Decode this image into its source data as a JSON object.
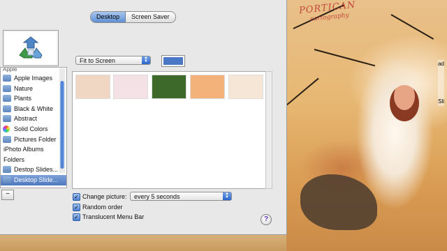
{
  "tabs": [
    {
      "label": "Desktop",
      "selected": true
    },
    {
      "label": "Screen Saver",
      "selected": false
    }
  ],
  "preview": {
    "icon": "refresh-cycle-icon"
  },
  "fit_popup": {
    "value": "Fit to Screen"
  },
  "color_swatch": {
    "color": "#4a77c6"
  },
  "sidebar": {
    "partial_header": "Apple",
    "items": [
      {
        "label": "Apple Images",
        "icon": "apple-logo-icon"
      },
      {
        "label": "Nature",
        "icon": "folder-icon"
      },
      {
        "label": "Plants",
        "icon": "folder-icon"
      },
      {
        "label": "Black & White",
        "icon": "folder-icon"
      },
      {
        "label": "Abstract",
        "icon": "folder-icon"
      },
      {
        "label": "Solid Colors",
        "icon": "color-wheel-icon"
      },
      {
        "label": "Pictures Folder",
        "icon": "folder-icon"
      }
    ],
    "iphoto_header": "iPhoto Albums",
    "folders_header": "Folders",
    "folder_items": [
      {
        "label": "Destop Slides...",
        "icon": "folder-icon",
        "selected": false
      },
      {
        "label": "Desktop Slide...",
        "icon": "folder-icon",
        "selected": true
      }
    ],
    "remove_button": "−"
  },
  "thumbnails": [
    {
      "name": "floral-card",
      "color": "#f0d7c4"
    },
    {
      "name": "pink-blossom",
      "color": "#f3e1e6"
    },
    {
      "name": "green-portrait",
      "color": "#3d6a2a"
    },
    {
      "name": "orange-scene",
      "color": "#f2b27a"
    },
    {
      "name": "pale-floral",
      "color": "#f5e6d6"
    }
  ],
  "options": {
    "change_picture_label": "Change picture:",
    "change_picture_checked": true,
    "interval_value": "every 5 seconds",
    "random_order_label": "Random order",
    "random_order_checked": true,
    "translucent_label": "Translucent Menu Bar",
    "translucent_checked": true
  },
  "help_label": "?",
  "wallpaper": {
    "title_line1": "PORTICAN",
    "title_line2": "cartography",
    "desktop_icon_labels": [
      "ad",
      "Sli"
    ]
  }
}
